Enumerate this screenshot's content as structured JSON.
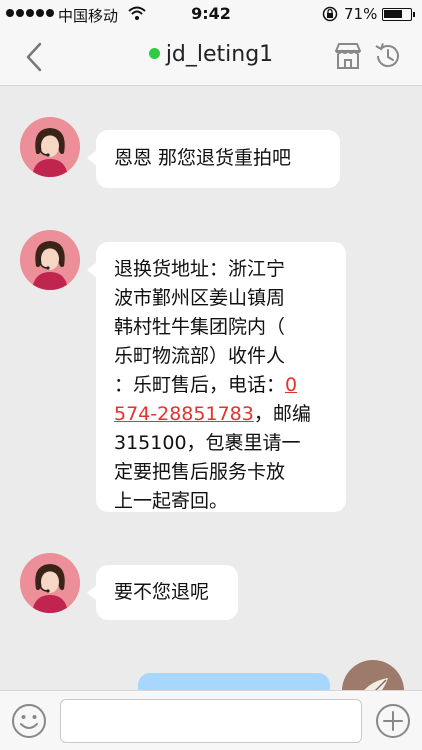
{
  "status_bar": {
    "carrier": "中国移动",
    "time": "9:42",
    "battery_percent_label": "71%",
    "battery_level": 0.71,
    "signal_bars": 5
  },
  "nav": {
    "contact_name": "jd_leting1",
    "online_color": "#2ecc40",
    "icons": [
      "back-chevron-icon",
      "store-icon",
      "history-clock-icon"
    ]
  },
  "messages": [
    {
      "sender": "agent",
      "text": "恩恩 那您退货重拍吧"
    },
    {
      "sender": "agent",
      "text_before_phone": "退换货地址：浙江宁\n波市鄞州区姜山镇周\n韩村牡牛集团院内（\n乐町物流部）收件人\n：乐町售后，电话：",
      "phone_line1": "0",
      "phone_line2": "574-28851783",
      "text_after_phone": "，邮编\n315100，包裹里请一\n定要把售后服务卡放\n上一起寄回。"
    },
    {
      "sender": "agent",
      "text": "要不您退呢"
    }
  ],
  "colors": {
    "background": "#ebebeb",
    "agent_bubble": "#ffffff",
    "user_bubble": "#a7d7ff",
    "avatar_bg": "#ed8f98",
    "link": "#e5322d"
  },
  "input_bar": {
    "placeholder": "",
    "icons": [
      "emoji-icon",
      "plus-icon"
    ]
  }
}
